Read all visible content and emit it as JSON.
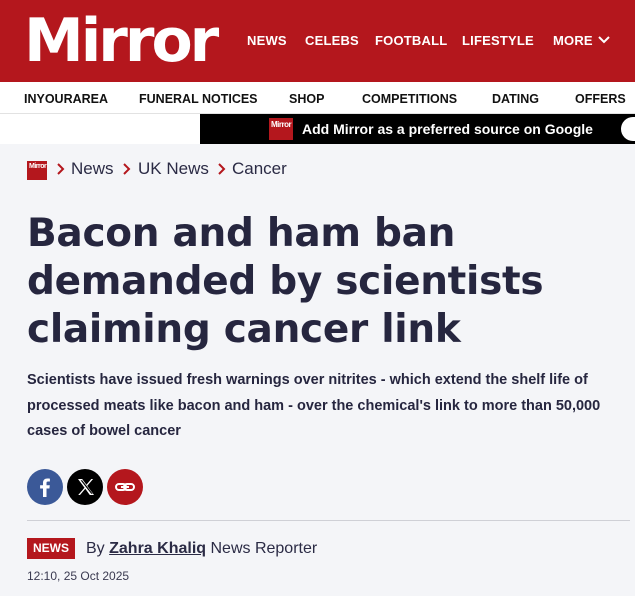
{
  "header": {
    "logo_text": "Mirror",
    "nav": [
      "NEWS",
      "CELEBS",
      "FOOTBALL",
      "LIFESTYLE",
      "MORE"
    ],
    "more_icon": "chevron-down-icon",
    "brand_color": "#b4171d"
  },
  "secondary_nav": [
    "INYOURAREA",
    "FUNERAL NOTICES",
    "SHOP",
    "COMPETITIONS",
    "DATING",
    "OFFERS"
  ],
  "promo": {
    "logo_text": "Mirror",
    "text": "Add Mirror as a preferred source on Google"
  },
  "breadcrumb": {
    "logo_text": "Mirror",
    "items": [
      "News",
      "UK News",
      "Cancer"
    ],
    "separator_icon": "chevron-right-icon"
  },
  "article": {
    "headline": "Bacon and ham ban demanded by scientists claiming cancer link",
    "standfirst": "Scientists have issued fresh warnings over nitrites - which extend the shelf life of processed meats like bacon and ham - over the chemical's link to more than 50,000 cases of bowel cancer",
    "share_buttons": [
      {
        "name": "facebook-icon",
        "color": "#3b5998"
      },
      {
        "name": "x-icon",
        "color": "#000000"
      },
      {
        "name": "link-icon",
        "color": "#b4171d"
      }
    ],
    "badge": "NEWS",
    "by": "By",
    "author": "Zahra Khaliq",
    "role": "News Reporter",
    "timestamp": "12:10, 25 Oct 2025"
  }
}
